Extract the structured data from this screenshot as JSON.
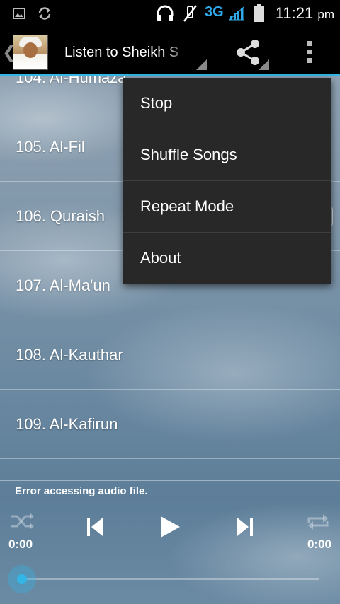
{
  "status_bar": {
    "time": "11:21",
    "ampm": "pm",
    "network": "3G",
    "icons": [
      "image-icon",
      "sync-icon",
      "headset-icon",
      "mute-icon",
      "signal-icon",
      "battery-icon"
    ]
  },
  "action_bar": {
    "title": "Listen to Sheikh S",
    "share_icon": "share-icon",
    "overflow_icon": "overflow-menu-icon"
  },
  "tracks": [
    "104. Al-Humaza",
    "105. Al-Fil",
    "106. Quraish",
    "107. Al-Ma'un",
    "108. Al-Kauthar",
    "109. Al-Kafirun"
  ],
  "menu": {
    "items": [
      "Stop",
      "Shuffle Songs",
      "Repeat Mode",
      "About"
    ]
  },
  "player": {
    "status_message": "Error accessing audio file.",
    "elapsed": "0:00",
    "duration": "0:00",
    "progress": 0,
    "controls": [
      "shuffle-icon",
      "previous-icon",
      "play-icon",
      "next-icon",
      "repeat-icon"
    ]
  },
  "colors": {
    "accent": "#33b5e5",
    "menu_bg": "#282828"
  }
}
